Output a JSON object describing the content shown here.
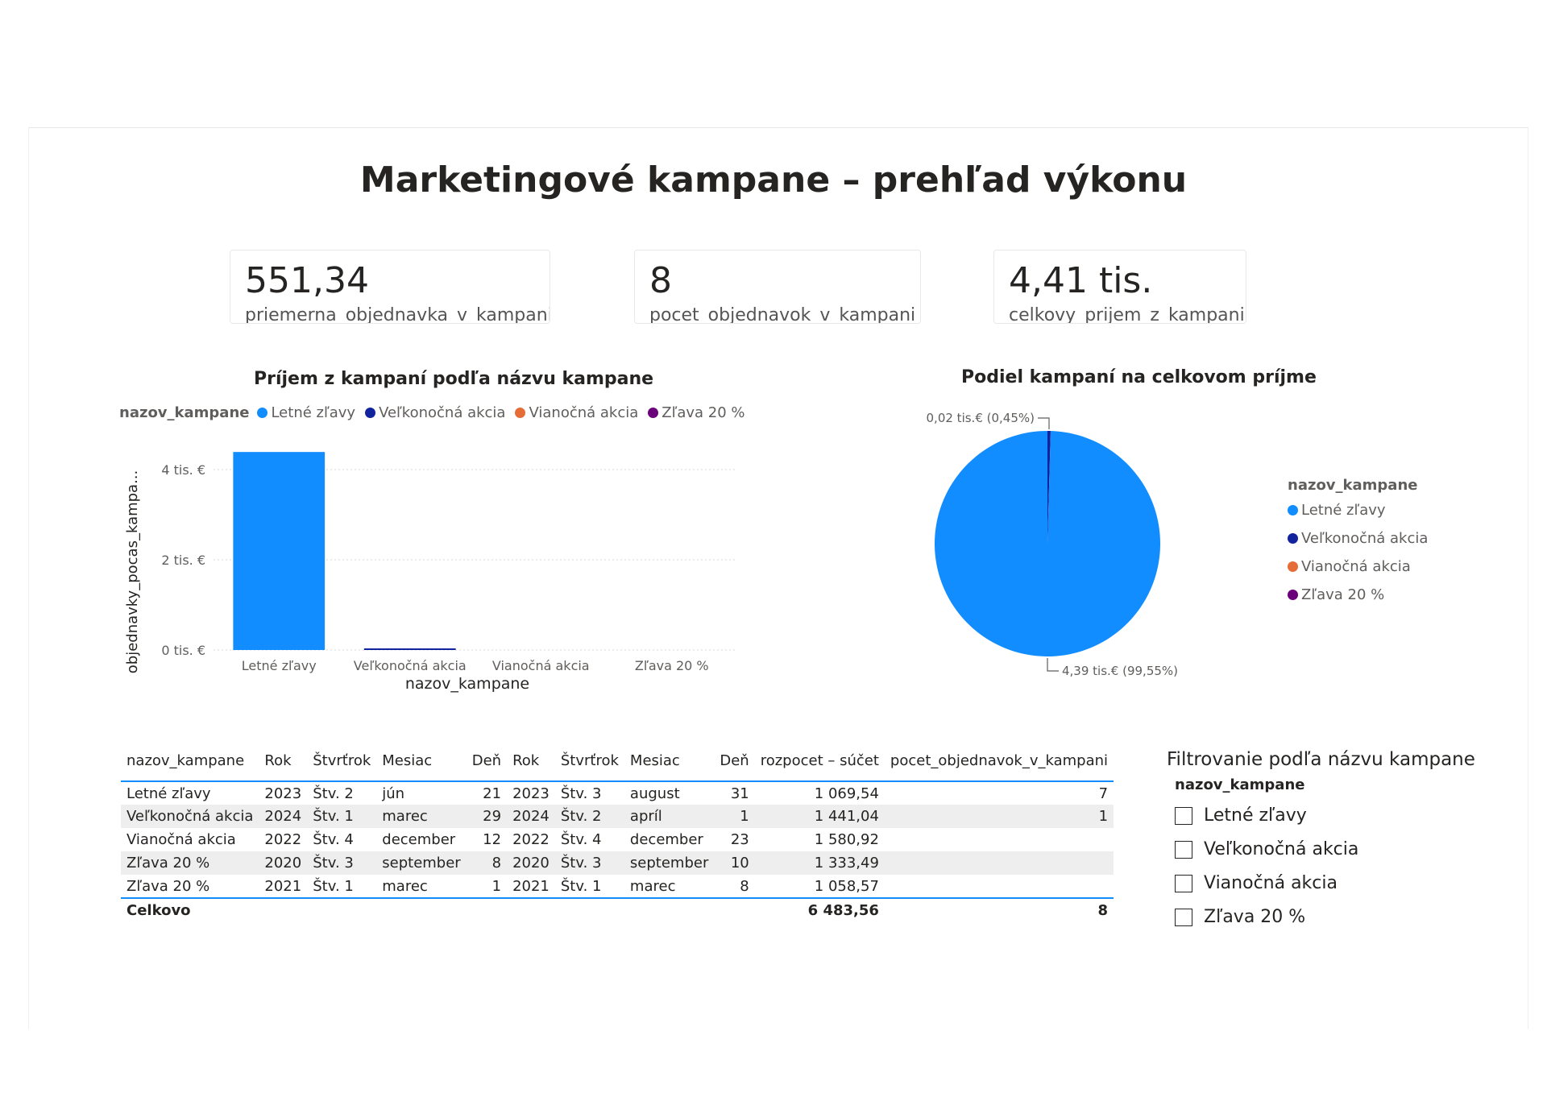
{
  "report": {
    "title": "Marketingové kampane – prehľad výkonu"
  },
  "kpis": [
    {
      "value": "551,34",
      "label": "priemerna_objednavka_v_kampani"
    },
    {
      "value": "8",
      "label": "pocet_objednavok_v_kampani"
    },
    {
      "value": "4,41 tis.",
      "label": "celkovy_prijem_z_kampani"
    }
  ],
  "bar_chart": {
    "title": "Príjem z kampaní podľa názvu kampane",
    "legend_title": "nazov_kampane",
    "legend": [
      {
        "name": "Letné zľavy",
        "color": "#118dff"
      },
      {
        "name": "Veľkonočná akcia",
        "color": "#12239e"
      },
      {
        "name": "Vianočná akcia",
        "color": "#e66c37"
      },
      {
        "name": "Zľava 20 %",
        "color": "#6b007b"
      }
    ]
  },
  "pie_chart": {
    "title": "Podiel kampaní na celkovom príjme",
    "legend_title": "nazov_kampane",
    "legend": [
      {
        "name": "Letné zľavy",
        "color": "#118dff"
      },
      {
        "name": "Veľkonočná akcia",
        "color": "#12239e"
      },
      {
        "name": "Vianočná akcia",
        "color": "#e66c37"
      },
      {
        "name": "Zľava 20 %",
        "color": "#6b007b"
      }
    ]
  },
  "chart_data": [
    {
      "type": "bar",
      "title": "Príjem z kampaní podľa názvu kampane",
      "xlabel": "nazov_kampane",
      "ylabel": "objednavky_pocas_kampa...",
      "categories": [
        "Letné zľavy",
        "Veľkonočná akcia",
        "Vianočná akcia",
        "Zľava 20 %"
      ],
      "values": [
        4390,
        20,
        0,
        0
      ],
      "colors": [
        "#118dff",
        "#12239e",
        "#e66c37",
        "#6b007b"
      ],
      "yticks": [
        0,
        2000,
        4000
      ],
      "ytick_labels": [
        "0 tis. €",
        "2 tis. €",
        "4 tis. €"
      ],
      "ylim": [
        0,
        4500
      ],
      "grid": true,
      "legend_position": "top-left"
    },
    {
      "type": "pie",
      "title": "Podiel kampaní na celkovom príjme",
      "labels": [
        "Letné zľavy",
        "Veľkonočná akcia"
      ],
      "values": [
        4390,
        20
      ],
      "colors": [
        "#118dff",
        "#12239e"
      ],
      "data_labels": [
        "4,39 tis.€ (99,55%)",
        "0,02 tis.€ (0,45%)"
      ],
      "legend_position": "right"
    }
  ],
  "table": {
    "columns": [
      "nazov_kampane",
      "Rok",
      "Štvrťrok",
      "Mesiac",
      "Deň",
      "Rok",
      "Štvrťrok",
      "Mesiac",
      "Deň",
      "rozpocet – súčet",
      "pocet_objednavok_v_kampani"
    ],
    "rows": [
      [
        "Letné zľavy",
        "2023",
        "Štv. 2",
        "jún",
        "21",
        "2023",
        "Štv. 3",
        "august",
        "31",
        "1 069,54",
        "7"
      ],
      [
        "Veľkonočná akcia",
        "2024",
        "Štv. 1",
        "marec",
        "29",
        "2024",
        "Štv. 2",
        "apríl",
        "1",
        "1 441,04",
        "1"
      ],
      [
        "Vianočná akcia",
        "2022",
        "Štv. 4",
        "december",
        "12",
        "2022",
        "Štv. 4",
        "december",
        "23",
        "1 580,92",
        ""
      ],
      [
        "Zľava 20 %",
        "2020",
        "Štv. 3",
        "september",
        "8",
        "2020",
        "Štv. 3",
        "september",
        "10",
        "1 333,49",
        ""
      ],
      [
        "Zľava 20 %",
        "2021",
        "Štv. 1",
        "marec",
        "1",
        "2021",
        "Štv. 1",
        "marec",
        "8",
        "1 058,57",
        ""
      ]
    ],
    "total": {
      "label": "Celkovo",
      "budget": "6 483,56",
      "orders": "8"
    }
  },
  "slicer": {
    "title": "Filtrovanie podľa názvu kampane",
    "field": "nazov_kampane",
    "items": [
      "Letné zľavy",
      "Veľkonočná akcia",
      "Vianočná akcia",
      "Zľava 20 %"
    ]
  }
}
